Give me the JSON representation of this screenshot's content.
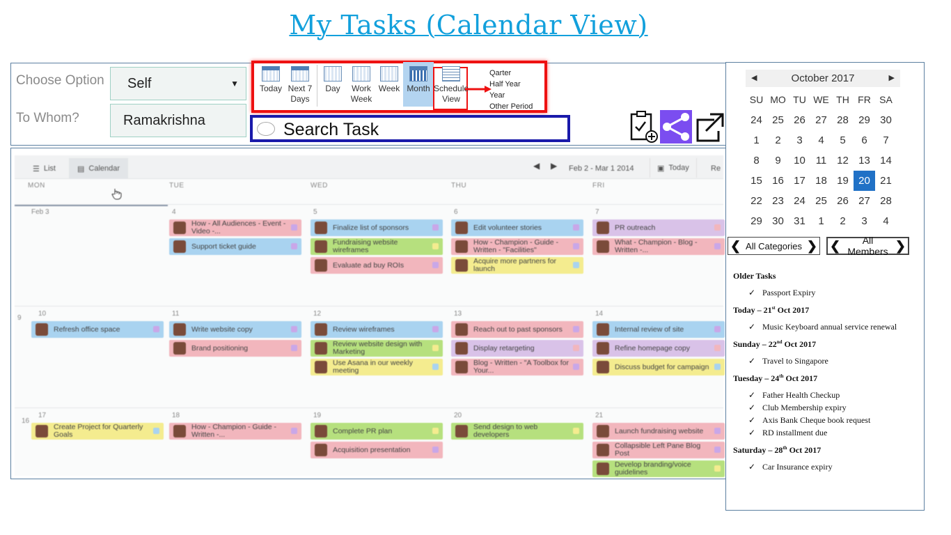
{
  "page_title": "My Tasks (Calendar View)",
  "options": {
    "choose_label": "Choose Option",
    "choose_value": "Self",
    "whom_label": "To Whom?",
    "whom_value": "Ramakrishna"
  },
  "views": [
    {
      "label": "Today",
      "sub": ""
    },
    {
      "label": "Next 7",
      "sub": "Days"
    },
    {
      "label": "Day",
      "sub": ""
    },
    {
      "label": "Work",
      "sub": "Week"
    },
    {
      "label": "Week",
      "sub": ""
    },
    {
      "label": "Month",
      "sub": ""
    },
    {
      "label": "Schedule",
      "sub": "View"
    }
  ],
  "selected_view": "Month",
  "periods": [
    "Qarter",
    "Half Year",
    "Year",
    "Other Period"
  ],
  "search": {
    "placeholder": "Search Task"
  },
  "tools": [
    "clipboard-add-icon",
    "share-icon",
    "expand-icon"
  ],
  "calendar": {
    "tab_list": "List",
    "tab_calendar": "Calendar",
    "date_range": "Feb 2 - Mar 1 2014",
    "today": "Today",
    "right_cut": "Re",
    "day_headers": [
      "MON",
      "TUE",
      "WED",
      "THU",
      "FRI"
    ],
    "week_numbers": [
      "9",
      "16"
    ],
    "weeks": [
      {
        "dates": [
          "Feb 3",
          "4",
          "5",
          "6",
          "7"
        ],
        "tasks": [
          [],
          [
            {
              "t": "How - All Audiences - Event - Video -...",
              "c": "red"
            },
            {
              "t": "Support ticket guide",
              "c": "blue"
            }
          ],
          [
            {
              "t": "Finalize list of sponsors",
              "c": "blue"
            },
            {
              "t": "Fundraising website wireframes",
              "c": "green"
            },
            {
              "t": "Evaluate ad buy ROIs",
              "c": "red"
            }
          ],
          [
            {
              "t": "Edit volunteer stories",
              "c": "blue"
            },
            {
              "t": "How - Champion - Guide - Written - \"Facilities\"",
              "c": "red"
            },
            {
              "t": "Acquire more partners for launch",
              "c": "yellow"
            }
          ],
          [
            {
              "t": "PR outreach",
              "c": "purple"
            },
            {
              "t": "What - Champion - Blog - Written -...",
              "c": "red"
            }
          ]
        ]
      },
      {
        "dates": [
          "10",
          "11",
          "12",
          "13",
          "14"
        ],
        "tasks": [
          [
            {
              "t": "Refresh office space",
              "c": "blue"
            }
          ],
          [
            {
              "t": "Write website copy",
              "c": "blue"
            },
            {
              "t": "Brand positioning",
              "c": "red"
            }
          ],
          [
            {
              "t": "Review wireframes",
              "c": "blue"
            },
            {
              "t": "Review website design with Marketing",
              "c": "green"
            },
            {
              "t": "Use Asana in our weekly meeting",
              "c": "yellow"
            }
          ],
          [
            {
              "t": "Reach out to past sponsors",
              "c": "red"
            },
            {
              "t": "Display retargeting",
              "c": "purple"
            },
            {
              "t": "Blog - Written - \"A Toolbox for Your...",
              "c": "red"
            }
          ],
          [
            {
              "t": "Internal review of site",
              "c": "blue"
            },
            {
              "t": "Refine homepage copy",
              "c": "purple"
            },
            {
              "t": "Discuss budget for campaign",
              "c": "yellow"
            }
          ]
        ]
      },
      {
        "dates": [
          "17",
          "18",
          "19",
          "20",
          "21"
        ],
        "tasks": [
          [
            {
              "t": "Create Project for Quarterly Goals",
              "c": "yellow"
            }
          ],
          [
            {
              "t": "How - Champion - Guide - Written -...",
              "c": "red"
            }
          ],
          [
            {
              "t": "Complete PR plan",
              "c": "green"
            },
            {
              "t": "Acquisition presentation",
              "c": "red"
            }
          ],
          [
            {
              "t": "Send design to web developers",
              "c": "green"
            }
          ],
          [
            {
              "t": "Launch fundraising website",
              "c": "red"
            },
            {
              "t": "Collapsible Left Pane Blog Post",
              "c": "red"
            },
            {
              "t": "Develop branding/voice guidelines",
              "c": "green"
            }
          ]
        ]
      }
    ]
  },
  "mini_calendar": {
    "month": "October 2017",
    "dow": [
      "SU",
      "MO",
      "TU",
      "WE",
      "TH",
      "FR",
      "SA"
    ],
    "days": [
      "24",
      "25",
      "26",
      "27",
      "28",
      "29",
      "30",
      "1",
      "2",
      "3",
      "4",
      "5",
      "6",
      "7",
      "8",
      "9",
      "10",
      "11",
      "12",
      "13",
      "14",
      "15",
      "16",
      "17",
      "18",
      "19",
      "20",
      "21",
      "22",
      "23",
      "24",
      "25",
      "26",
      "27",
      "28",
      "29",
      "30",
      "31",
      "1",
      "2",
      "3",
      "4"
    ],
    "selected": "20"
  },
  "filters": {
    "categories": "All Categories",
    "members": "All Members"
  },
  "task_list": [
    {
      "head": "Older Tasks",
      "items": [
        "Passport Expiry"
      ]
    },
    {
      "head": "Today – 21st Oct 2017",
      "items": [
        "Music Keyboard annual service renewal"
      ]
    },
    {
      "head": "Sunday – 22nd Oct 2017",
      "items": [
        "Travel to Singapore"
      ]
    },
    {
      "head": "Tuesday – 24th Oct 2017",
      "items": [
        "Father Health Checkup",
        "Club Membership expiry",
        "Axis Bank Cheque book request",
        "RD installment due"
      ]
    },
    {
      "head": "Saturday – 28th Oct 2017",
      "items": [
        "Car Insurance expiry"
      ]
    }
  ],
  "colors": {
    "title": "#12a0dc",
    "highlight_red": "#e11111",
    "search_border": "#1a1aaa",
    "selected_day": "#2071c6",
    "share_bg": "#7b4df0"
  }
}
